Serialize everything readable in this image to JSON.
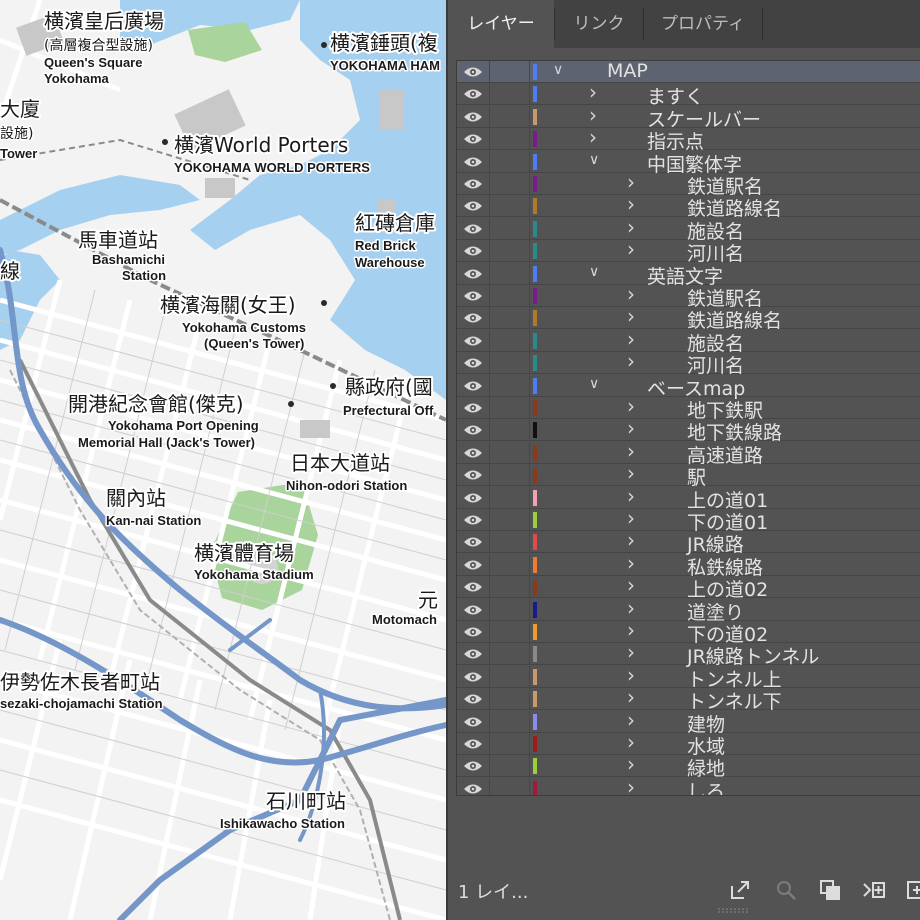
{
  "map": {
    "labels": [
      {
        "id": "queens-square-ja",
        "text": "横濱皇后廣場",
        "kind": "ja"
      },
      {
        "id": "queens-square-sub",
        "text": "(高層複合型設施)",
        "kind": "sub"
      },
      {
        "id": "queens-square-en1",
        "text": "Queen's Square",
        "kind": "en"
      },
      {
        "id": "queens-square-en2",
        "text": "Yokohama",
        "kind": "en"
      },
      {
        "id": "hammerhead-ja",
        "text": "横濱錘頭(複",
        "kind": "ja"
      },
      {
        "id": "hammerhead-en",
        "text": "YOKOHAMA HAM",
        "kind": "en"
      },
      {
        "id": "building-ja",
        "text": "大廈",
        "kind": "ja"
      },
      {
        "id": "building-sub",
        "text": "設施)",
        "kind": "sub"
      },
      {
        "id": "building-en",
        "text": "Tower",
        "kind": "en"
      },
      {
        "id": "world-porters-ja",
        "text": "横濱World Porters",
        "kind": "ja"
      },
      {
        "id": "world-porters-en",
        "text": "YOKOHAMA WORLD PORTERS",
        "kind": "en"
      },
      {
        "id": "red-brick-ja",
        "text": "紅磚倉庫",
        "kind": "ja"
      },
      {
        "id": "red-brick-en1",
        "text": "Red Brick",
        "kind": "en"
      },
      {
        "id": "red-brick-en2",
        "text": "Warehouse",
        "kind": "en"
      },
      {
        "id": "bashamichi-ja",
        "text": "馬車道站",
        "kind": "ja"
      },
      {
        "id": "bashamichi-en1",
        "text": "Bashamichi",
        "kind": "en"
      },
      {
        "id": "bashamichi-en2",
        "text": "Station",
        "kind": "en"
      },
      {
        "id": "line-ja",
        "text": "線",
        "kind": "ja"
      },
      {
        "id": "customs-ja",
        "text": "横濱海關(女王)",
        "kind": "ja"
      },
      {
        "id": "customs-en1",
        "text": "Yokohama Customs",
        "kind": "en"
      },
      {
        "id": "customs-en2",
        "text": "(Queen's Tower)",
        "kind": "en"
      },
      {
        "id": "prefectural-ja",
        "text": "縣政府(國",
        "kind": "ja"
      },
      {
        "id": "prefectural-en",
        "text": "Prefectural Off",
        "kind": "en"
      },
      {
        "id": "memorial-ja",
        "text": "開港紀念會館(傑克)",
        "kind": "ja"
      },
      {
        "id": "memorial-en1",
        "text": "Yokohama Port Opening",
        "kind": "en"
      },
      {
        "id": "memorial-en2",
        "text": "Memorial Hall (Jack's Tower)",
        "kind": "en"
      },
      {
        "id": "nihon-odori-ja",
        "text": "日本大道站",
        "kind": "ja"
      },
      {
        "id": "nihon-odori-en",
        "text": "Nihon-odori Station",
        "kind": "en"
      },
      {
        "id": "kannai-ja",
        "text": "關內站",
        "kind": "ja"
      },
      {
        "id": "kannai-en",
        "text": "Kan-nai Station",
        "kind": "en"
      },
      {
        "id": "stadium-ja",
        "text": "横濱體育場",
        "kind": "ja"
      },
      {
        "id": "stadium-en",
        "text": "Yokohama Stadium",
        "kind": "en"
      },
      {
        "id": "motomachi-ja",
        "text": "元",
        "kind": "ja"
      },
      {
        "id": "motomachi-en",
        "text": "Motomach",
        "kind": "en"
      },
      {
        "id": "isezaki-ja",
        "text": "伊勢佐木長者町站",
        "kind": "ja"
      },
      {
        "id": "isezaki-en",
        "text": "sezaki-chojamachi Station",
        "kind": "en"
      },
      {
        "id": "ishikawacho-ja",
        "text": "石川町站",
        "kind": "ja"
      },
      {
        "id": "ishikawacho-en",
        "text": "Ishikawacho Station",
        "kind": "en"
      }
    ],
    "colors": {
      "water": "#a6d0ef",
      "park": "#a9d49c",
      "river": "#7496c8",
      "road": "#ffffff",
      "block": "#e6e6e6",
      "rail": "#8a8a8a",
      "background": "#f3f3f3"
    }
  },
  "panel": {
    "tabs": [
      {
        "label": "レイヤー",
        "active": true
      },
      {
        "label": "リンク",
        "active": false
      },
      {
        "label": "プロパティ",
        "active": false
      }
    ],
    "layers": [
      {
        "name": "MAP",
        "depth": 0,
        "expanded": true,
        "color": "#4f7df5",
        "selected": true
      },
      {
        "name": "ますく",
        "depth": 1,
        "expanded": false,
        "color": "#4f7df5"
      },
      {
        "name": "スケールバー",
        "depth": 1,
        "expanded": false,
        "color": "#c79a6b"
      },
      {
        "name": "指示点",
        "depth": 1,
        "expanded": false,
        "color": "#7a1a8c"
      },
      {
        "name": "中国繁体字",
        "depth": 1,
        "expanded": true,
        "color": "#4f7df5"
      },
      {
        "name": "鉄道駅名",
        "depth": 2,
        "expanded": false,
        "color": "#7a1a8c"
      },
      {
        "name": "鉄道路線名",
        "depth": 2,
        "expanded": false,
        "color": "#b07a2a"
      },
      {
        "name": "施設名",
        "depth": 2,
        "expanded": false,
        "color": "#2a8a8a"
      },
      {
        "name": "河川名",
        "depth": 2,
        "expanded": false,
        "color": "#2a8a8a"
      },
      {
        "name": "英語文字",
        "depth": 1,
        "expanded": true,
        "color": "#4f7df5"
      },
      {
        "name": "鉄道駅名",
        "depth": 2,
        "expanded": false,
        "color": "#7a1a8c"
      },
      {
        "name": "鉄道路線名",
        "depth": 2,
        "expanded": false,
        "color": "#b07a2a"
      },
      {
        "name": "施設名",
        "depth": 2,
        "expanded": false,
        "color": "#2a8a8a"
      },
      {
        "name": "河川名",
        "depth": 2,
        "expanded": false,
        "color": "#2a8a8a"
      },
      {
        "name": "ベースmap",
        "depth": 1,
        "expanded": true,
        "color": "#4f7df5"
      },
      {
        "name": "地下鉄駅",
        "depth": 2,
        "expanded": false,
        "color": "#8a3a1a"
      },
      {
        "name": "地下鉄線路",
        "depth": 2,
        "expanded": false,
        "color": "#111111"
      },
      {
        "name": "高速道路",
        "depth": 2,
        "expanded": false,
        "color": "#8a3a1a"
      },
      {
        "name": "駅",
        "depth": 2,
        "expanded": false,
        "color": "#8a3a1a"
      },
      {
        "name": "上の道01",
        "depth": 2,
        "expanded": false,
        "color": "#f2a0b4"
      },
      {
        "name": "下の道01",
        "depth": 2,
        "expanded": false,
        "color": "#9ccf3a"
      },
      {
        "name": "JR線路",
        "depth": 2,
        "expanded": false,
        "color": "#e04a4a"
      },
      {
        "name": "私鉄線路",
        "depth": 2,
        "expanded": false,
        "color": "#f07a30"
      },
      {
        "name": "上の道02",
        "depth": 2,
        "expanded": false,
        "color": "#8a3a1a"
      },
      {
        "name": "道塗り",
        "depth": 2,
        "expanded": false,
        "color": "#1a1a8c"
      },
      {
        "name": "下の道02",
        "depth": 2,
        "expanded": false,
        "color": "#f09a30"
      },
      {
        "name": "JR線路トンネル",
        "depth": 2,
        "expanded": false,
        "color": "#8a8a8a"
      },
      {
        "name": "トンネル上",
        "depth": 2,
        "expanded": false,
        "color": "#c79a6b"
      },
      {
        "name": "トンネル下",
        "depth": 2,
        "expanded": false,
        "color": "#c79a6b"
      },
      {
        "name": "建物",
        "depth": 2,
        "expanded": false,
        "color": "#8a8af0"
      },
      {
        "name": "水域",
        "depth": 2,
        "expanded": false,
        "color": "#a01a1a"
      },
      {
        "name": "緑地",
        "depth": 2,
        "expanded": false,
        "color": "#9ccf3a"
      },
      {
        "name": "しろ",
        "depth": 2,
        "expanded": false,
        "color": "#a01a3a"
      }
    ],
    "footer": {
      "layer_count": "1 レイ...",
      "icons": [
        "export-icon",
        "search-layer-icon",
        "clipping-mask-icon",
        "new-sublayer-icon",
        "new-layer-icon"
      ]
    }
  }
}
